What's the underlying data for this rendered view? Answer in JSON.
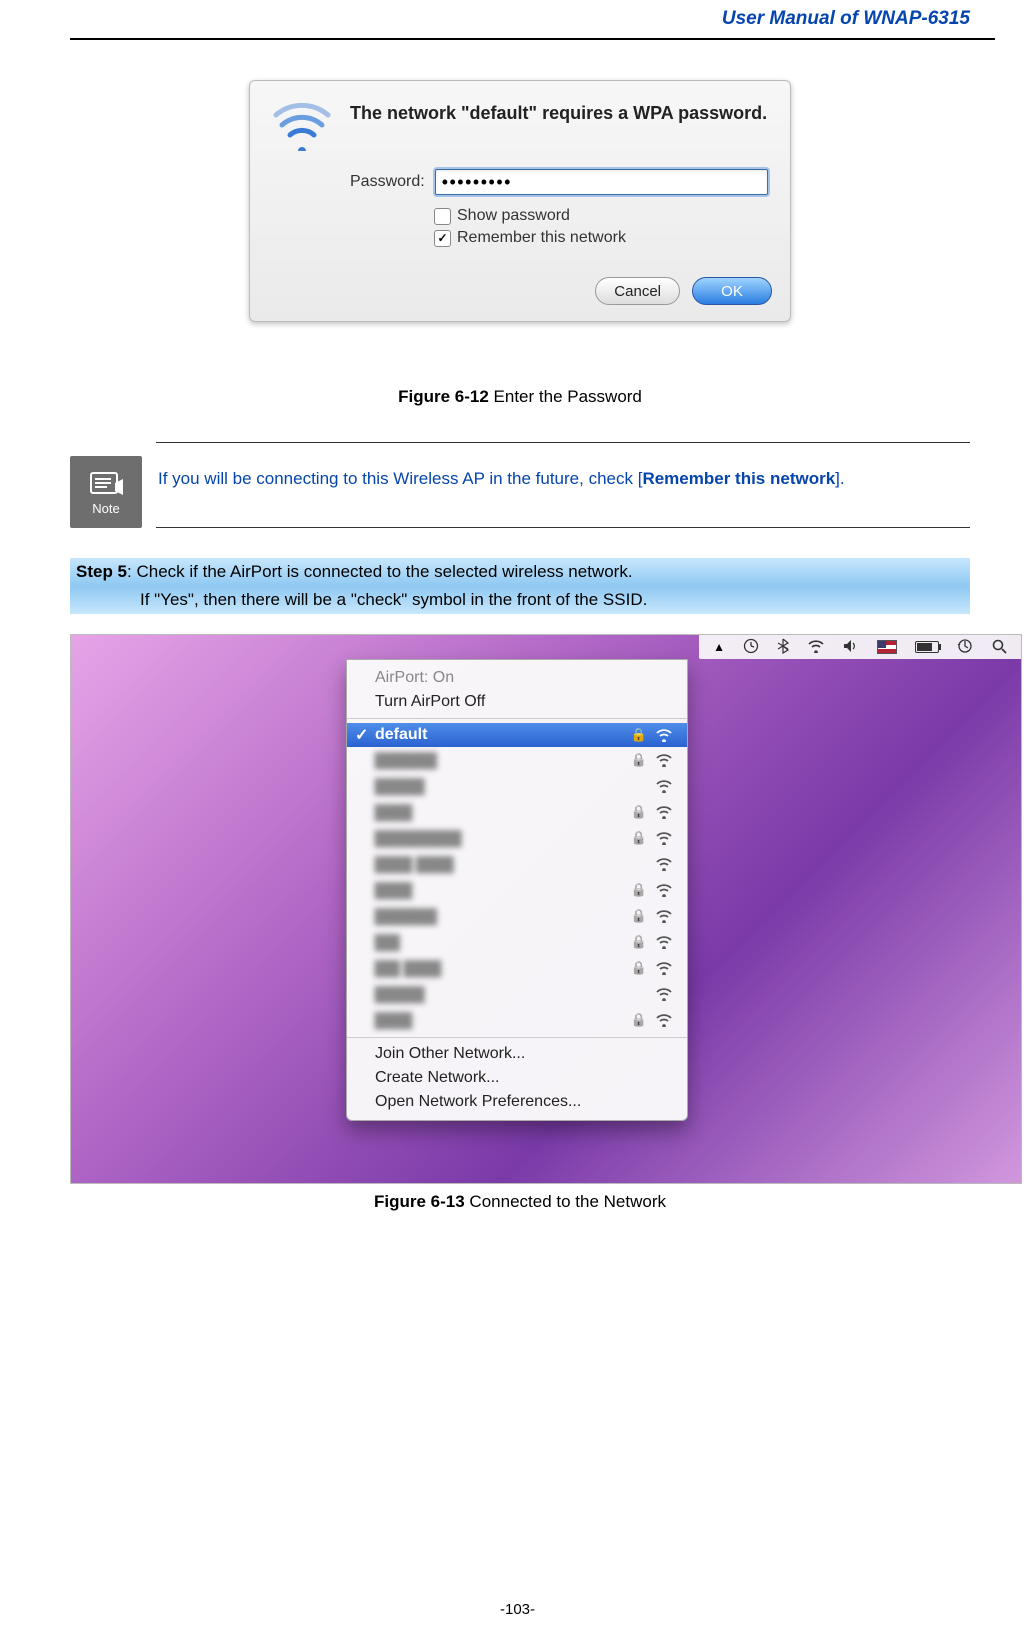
{
  "header": {
    "title": "User Manual of WNAP-6315"
  },
  "dialog": {
    "message": "The network \"default\" requires a WPA password.",
    "password_label": "Password:",
    "password_value": "•••••••••",
    "show_password_label": "Show password",
    "show_password_checked": false,
    "remember_label": "Remember this network",
    "remember_checked": true,
    "cancel_label": "Cancel",
    "ok_label": "OK"
  },
  "fig1": {
    "num": "Figure 6-12",
    "text": " Enter the Password"
  },
  "note": {
    "icon_label": "Note",
    "text_pre": "If you will be connecting to this Wireless AP in the future, check [",
    "text_kw": "Remember this network",
    "text_post": "]."
  },
  "step": {
    "label": "Step 5",
    "line1": ": Check if the AirPort is connected to the selected wireless network.",
    "line2": "If \"Yes\", then there will be a \"check\" symbol in the front of the SSID."
  },
  "dropdown": {
    "status": "AirPort: On",
    "turn_off": "Turn AirPort Off",
    "selected_ssid": "default",
    "other_items_count": 10,
    "join": "Join Other Network...",
    "create": "Create Network...",
    "prefs": "Open Network Preferences..."
  },
  "menubar": {
    "icons": [
      "triangle",
      "clock",
      "bluetooth",
      "wifi",
      "volume",
      "flag",
      "battery",
      "timemachine",
      "search"
    ]
  },
  "network_list": [
    {
      "locked": true,
      "signal": 3
    },
    {
      "locked": true,
      "signal": 3
    },
    {
      "locked": false,
      "signal": 3
    },
    {
      "locked": true,
      "signal": 2
    },
    {
      "locked": true,
      "signal": 3
    },
    {
      "locked": false,
      "signal": 3
    },
    {
      "locked": true,
      "signal": 3
    },
    {
      "locked": true,
      "signal": 2
    },
    {
      "locked": true,
      "signal": 3
    },
    {
      "locked": true,
      "signal": 3
    },
    {
      "locked": false,
      "signal": 3
    },
    {
      "locked": true,
      "signal": 2
    }
  ],
  "fig2": {
    "num": "Figure 6-13",
    "text": " Connected to the Network"
  },
  "footer": {
    "page": "-103-"
  }
}
